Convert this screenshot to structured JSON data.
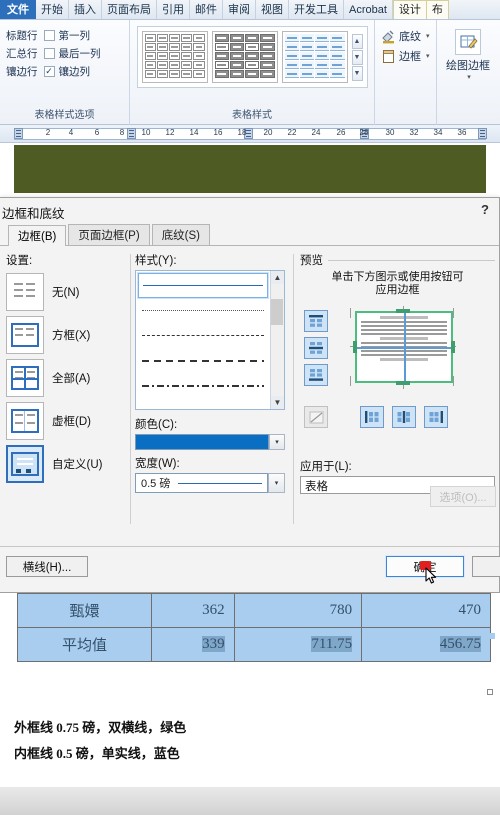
{
  "ribbon": {
    "tabs": [
      {
        "label": "文件",
        "state": "file"
      },
      {
        "label": "开始",
        "state": "normal"
      },
      {
        "label": "插入",
        "state": "normal"
      },
      {
        "label": "页面布局",
        "state": "normal"
      },
      {
        "label": "引用",
        "state": "normal"
      },
      {
        "label": "邮件",
        "state": "normal"
      },
      {
        "label": "审阅",
        "state": "normal"
      },
      {
        "label": "视图",
        "state": "normal"
      },
      {
        "label": "开发工具",
        "state": "normal"
      },
      {
        "label": "Acrobat",
        "state": "normal"
      },
      {
        "label": "设计",
        "state": "active"
      },
      {
        "label": "布",
        "state": "contextual"
      }
    ],
    "table_style_options": {
      "group_title": "表格样式选项",
      "items": [
        {
          "label": "标题行",
          "checked": false
        },
        {
          "label": "第一列",
          "checked": false
        },
        {
          "label": "汇总行",
          "checked": false
        },
        {
          "label": "最后一列",
          "checked": false
        },
        {
          "label": "镶边行",
          "checked": false
        },
        {
          "label": "镶边列",
          "checked": true
        }
      ]
    },
    "table_styles": {
      "group_title": "表格样式",
      "scroll_up": "▲",
      "scroll_down": "▼",
      "more": "▼"
    },
    "borders_group": {
      "shading_label": "底纹",
      "borders_label": "边框",
      "draw_borders_label": "绘图边框",
      "caret": "▾"
    }
  },
  "ruler": {
    "numbers": [
      "2",
      "4",
      "6",
      "8",
      "10",
      "12",
      "14",
      "16",
      "18",
      "20",
      "22",
      "24",
      "26",
      "28",
      "30",
      "32",
      "34",
      "36"
    ]
  },
  "dialog": {
    "title": "边框和底纹",
    "help": "?",
    "tabs": [
      {
        "label": "边框(B)",
        "selected": true
      },
      {
        "label": "页面边框(P)",
        "selected": false
      },
      {
        "label": "底纹(S)",
        "selected": false
      }
    ],
    "settings": {
      "label": "设置:",
      "options": [
        {
          "label": "无(N)",
          "selected": false
        },
        {
          "label": "方框(X)",
          "selected": false
        },
        {
          "label": "全部(A)",
          "selected": false
        },
        {
          "label": "虚框(D)",
          "selected": false
        },
        {
          "label": "自定义(U)",
          "selected": true
        }
      ]
    },
    "style": {
      "label": "样式(Y):",
      "items": [
        {
          "kind": "solid",
          "selected": true
        },
        {
          "kind": "dotted",
          "selected": false
        },
        {
          "kind": "dash-small",
          "selected": false
        },
        {
          "kind": "dashed",
          "selected": false
        },
        {
          "kind": "dash-dot",
          "selected": false
        }
      ]
    },
    "color": {
      "label": "颜色(C):",
      "value": "#0a6fc2",
      "caret": "▾"
    },
    "width": {
      "label": "宽度(W):",
      "value": "0.5 磅",
      "caret": "▾"
    },
    "preview": {
      "label": "预览",
      "hint_line1": "单击下方图示或使用按钮可",
      "hint_line2": "应用边框",
      "outer_color": "#4dbd7f",
      "inner_color": "#5b9bd5"
    },
    "apply_to": {
      "label": "应用于(L):",
      "value": "表格"
    },
    "options_button": "选项(O)...",
    "footer": {
      "horizontal_line_button": "横线(H)...",
      "ok_button": "确定",
      "cancel_button": "取"
    }
  },
  "document": {
    "table": {
      "rows": [
        {
          "label": "甄嬛",
          "values": [
            "362",
            "780",
            "470"
          ],
          "highlight": true,
          "selected_values": false
        },
        {
          "label": "平均值",
          "values": [
            "339",
            "711.75",
            "456.75"
          ],
          "highlight": true,
          "selected_values": true
        }
      ]
    },
    "captions": [
      "外框线 0.75 磅，双横线，绿色",
      "内框线 0.5 磅，单实线，蓝色"
    ]
  }
}
